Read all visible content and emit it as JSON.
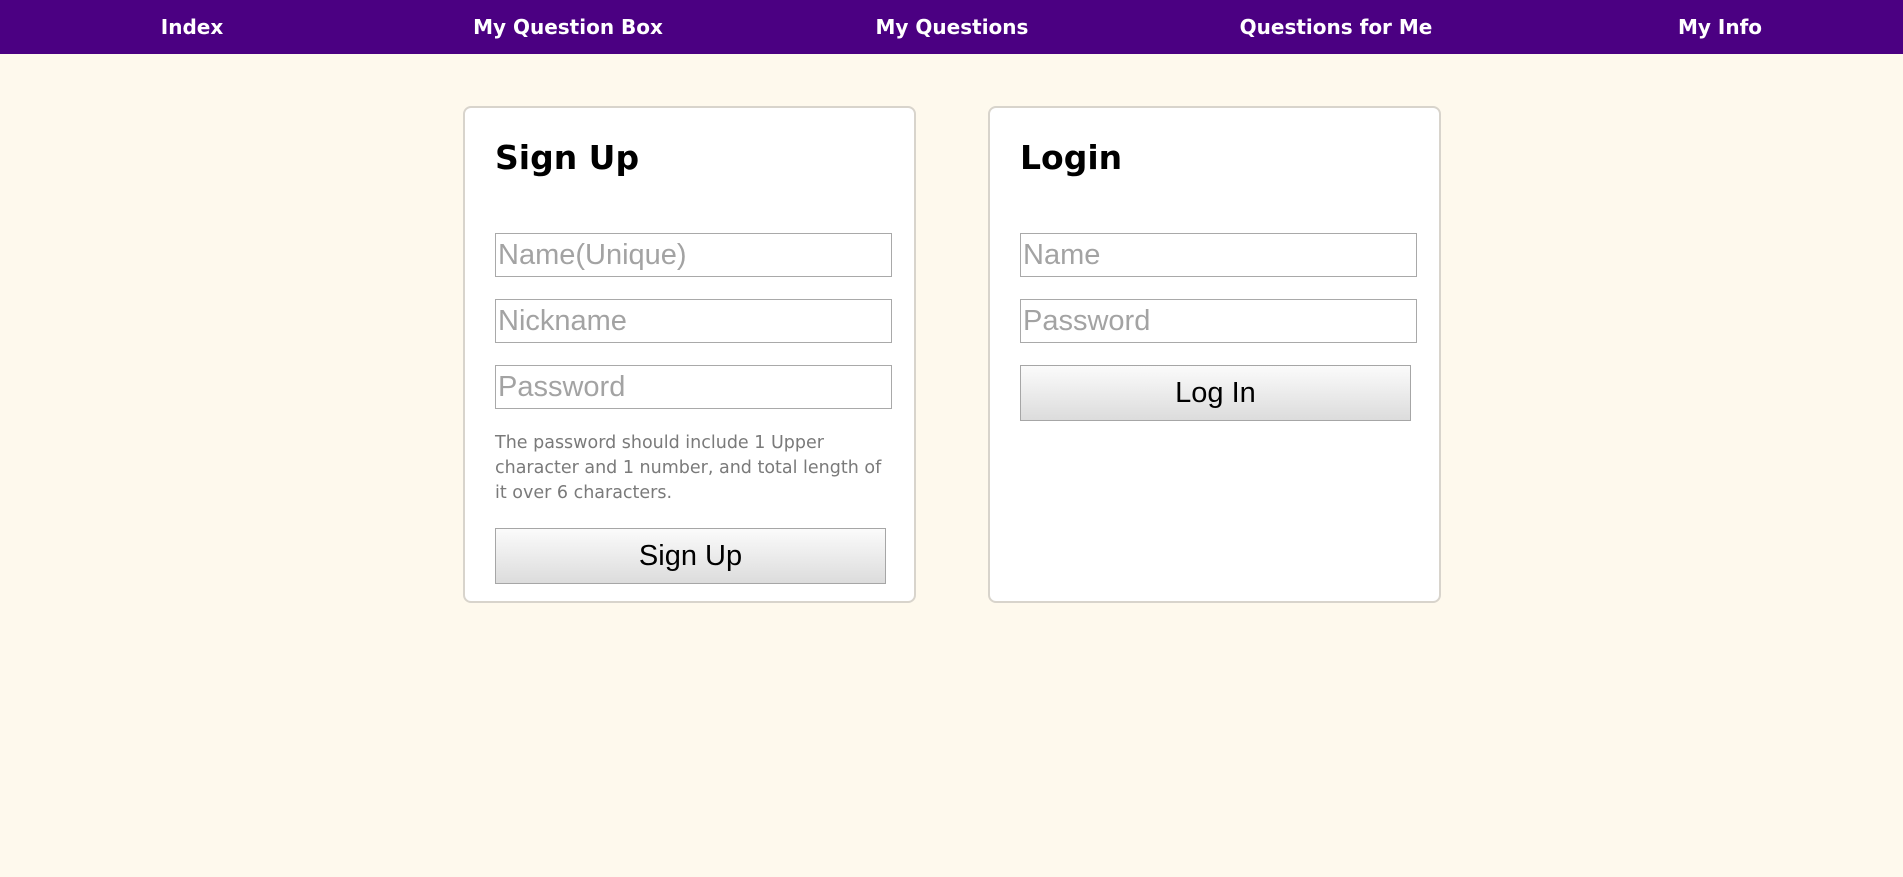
{
  "nav": {
    "items": [
      {
        "label": "Index"
      },
      {
        "label": "My Question Box"
      },
      {
        "label": "My Questions"
      },
      {
        "label": "Questions for Me"
      },
      {
        "label": "My Info"
      }
    ]
  },
  "signup": {
    "title": "Sign Up",
    "name_placeholder": "Name(Unique)",
    "nickname_placeholder": "Nickname",
    "password_placeholder": "Password",
    "hint": "The password should include 1 Upper character and 1 number, and total length of it over 6 characters.",
    "button_label": "Sign Up"
  },
  "login": {
    "title": "Login",
    "name_placeholder": "Name",
    "password_placeholder": "Password",
    "button_label": "Log In"
  },
  "colors": {
    "nav_background": "#4b0082",
    "page_background": "#fef9ed"
  }
}
